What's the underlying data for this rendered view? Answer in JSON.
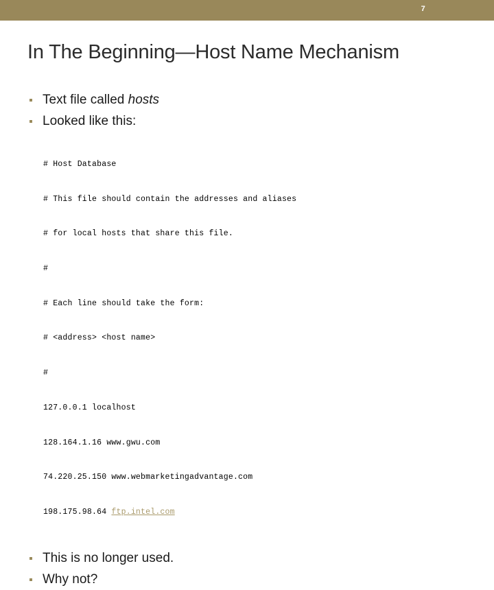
{
  "slide": {
    "number": "7",
    "title": "In The Beginning—Host Name Mechanism",
    "accent_color": "#99885a",
    "bullet_color": "#9a8b5c",
    "title_color": "#2b2b2b",
    "link_color": "#a99a6b"
  },
  "bullets_top": [
    {
      "text_before": "Text file called ",
      "emphasis": "hosts",
      "text_after": ""
    },
    {
      "text_before": "Looked like this:",
      "emphasis": "",
      "text_after": ""
    }
  ],
  "code": {
    "lines": [
      {
        "text": "# Host Database",
        "link": ""
      },
      {
        "text": "# This file should contain the addresses and aliases",
        "link": ""
      },
      {
        "text": "# for local hosts that share this file.",
        "link": ""
      },
      {
        "text": "#",
        "link": ""
      },
      {
        "text": "# Each line should take the form:",
        "link": ""
      },
      {
        "text": "# <address> <host name>",
        "link": ""
      },
      {
        "text": "#",
        "link": ""
      },
      {
        "text": "127.0.0.1 localhost",
        "link": ""
      },
      {
        "text": "128.164.1.16 www.gwu.com",
        "link": ""
      },
      {
        "text": "74.220.25.150 www.webmarketingadvantage.com",
        "link": ""
      },
      {
        "text": "198.175.98.64 ",
        "link": "ftp.intel.com"
      }
    ]
  },
  "bullets_bottom": [
    {
      "text": "This is no longer used."
    },
    {
      "text": "Why not?"
    }
  ]
}
